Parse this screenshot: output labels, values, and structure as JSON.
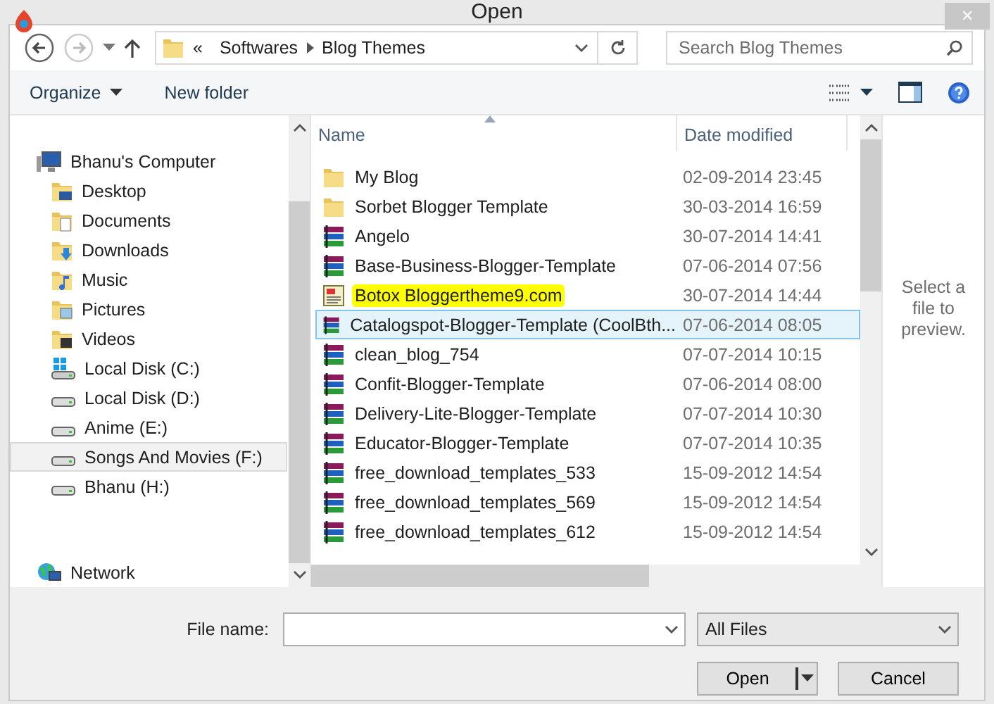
{
  "window": {
    "title": "Open",
    "close": "✕"
  },
  "address": {
    "overflow": "«",
    "crumbs": [
      "Softwares",
      "Blog Themes"
    ]
  },
  "search": {
    "placeholder": "Search Blog Themes"
  },
  "toolbar": {
    "organize": "Organize",
    "new_folder": "New folder"
  },
  "sidebar": {
    "items": [
      {
        "label": "Bhanu's Computer",
        "kind": "computer",
        "selected": false,
        "children": [
          {
            "label": "Desktop",
            "kind": "folder",
            "selected": false
          },
          {
            "label": "Documents",
            "kind": "folder",
            "selected": false
          },
          {
            "label": "Downloads",
            "kind": "folder",
            "selected": false
          },
          {
            "label": "Music",
            "kind": "folder",
            "selected": false
          },
          {
            "label": "Pictures",
            "kind": "folder",
            "selected": false
          },
          {
            "label": "Videos",
            "kind": "folder",
            "selected": false
          },
          {
            "label": "Local Disk (C:)",
            "kind": "system-drive",
            "selected": false
          },
          {
            "label": "Local Disk (D:)",
            "kind": "drive",
            "selected": false
          },
          {
            "label": "Anime (E:)",
            "kind": "drive",
            "selected": false
          },
          {
            "label": "Songs And Movies (F:)",
            "kind": "drive",
            "selected": true
          },
          {
            "label": "Bhanu (H:)",
            "kind": "drive",
            "selected": false
          }
        ]
      },
      {
        "label": "Network",
        "kind": "network",
        "selected": false
      }
    ]
  },
  "table": {
    "columns": [
      "Name",
      "Date modified"
    ],
    "rows": [
      {
        "name": "My Blog",
        "date": "02-09-2014 23:45",
        "kind": "folder",
        "selected": false,
        "highlighted": false
      },
      {
        "name": "Sorbet Blogger Template",
        "date": "30-03-2014 16:59",
        "kind": "folder",
        "selected": false,
        "highlighted": false
      },
      {
        "name": "Angelo",
        "date": "30-07-2014 14:41",
        "kind": "archive",
        "selected": false,
        "highlighted": false
      },
      {
        "name": "Base-Business-Blogger-Template",
        "date": "07-06-2014 07:56",
        "kind": "archive",
        "selected": false,
        "highlighted": false
      },
      {
        "name": "Botox Bloggertheme9.com",
        "date": "30-07-2014 14:44",
        "kind": "document",
        "selected": false,
        "highlighted": true
      },
      {
        "name": "Catalogspot-Blogger-Template (CoolBth...",
        "date": "07-06-2014 08:05",
        "kind": "archive",
        "selected": true,
        "highlighted": false
      },
      {
        "name": "clean_blog_754",
        "date": "07-07-2014 10:15",
        "kind": "archive",
        "selected": false,
        "highlighted": false
      },
      {
        "name": "Confit-Blogger-Template",
        "date": "07-06-2014 08:00",
        "kind": "archive",
        "selected": false,
        "highlighted": false
      },
      {
        "name": "Delivery-Lite-Blogger-Template",
        "date": "07-07-2014 10:30",
        "kind": "archive",
        "selected": false,
        "highlighted": false
      },
      {
        "name": "Educator-Blogger-Template",
        "date": "07-07-2014 10:35",
        "kind": "archive",
        "selected": false,
        "highlighted": false
      },
      {
        "name": "free_download_templates_533",
        "date": "15-09-2012 14:54",
        "kind": "archive",
        "selected": false,
        "highlighted": false
      },
      {
        "name": "free_download_templates_569",
        "date": "15-09-2012 14:54",
        "kind": "archive",
        "selected": false,
        "highlighted": false
      },
      {
        "name": "free_download_templates_612",
        "date": "15-09-2012 14:54",
        "kind": "archive",
        "selected": false,
        "highlighted": false
      }
    ]
  },
  "preview": {
    "message": "Select a file to preview."
  },
  "footer": {
    "file_name_label": "File name:",
    "file_type": "All Files",
    "open": "Open",
    "cancel": "Cancel"
  }
}
